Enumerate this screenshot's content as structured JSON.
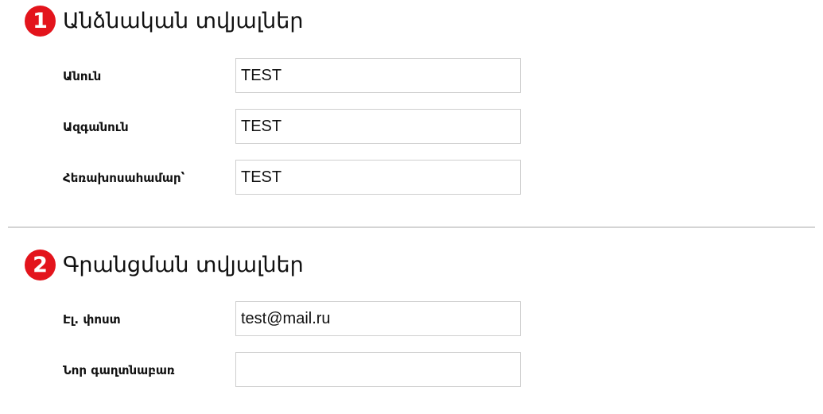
{
  "sections": [
    {
      "number": "1",
      "title": "Անձնական տվյալներ",
      "fields": [
        {
          "label": "Անուն",
          "value": "TEST",
          "placeholder": ""
        },
        {
          "label": "Ազգանուն",
          "value": "TEST",
          "placeholder": ""
        },
        {
          "label": "Հեռախոսահամար՝",
          "value": "TEST",
          "placeholder": ""
        }
      ]
    },
    {
      "number": "2",
      "title": "Գրանցման տվյալներ",
      "fields": [
        {
          "label": "Էլ. փոստ",
          "value": "test@mail.ru",
          "placeholder": ""
        },
        {
          "label": "Նոր գաղտնաբառ",
          "value": "",
          "placeholder": ""
        }
      ]
    }
  ],
  "colors": {
    "badge": "#e3141c",
    "divider": "#d4d4d4",
    "input_border": "#cfcfcf"
  }
}
